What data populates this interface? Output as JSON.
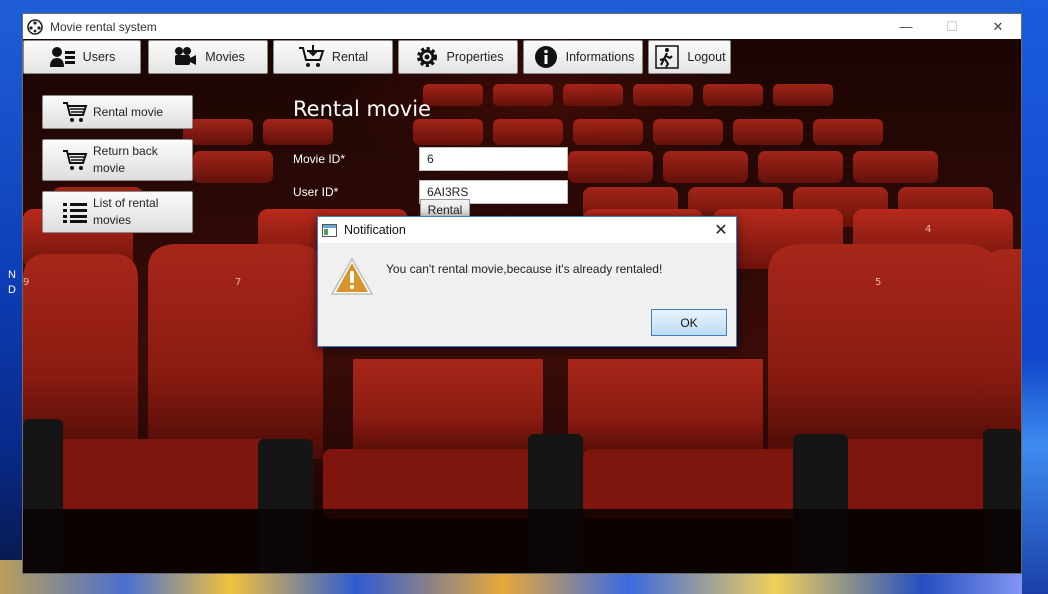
{
  "desktop": {
    "left_text": "N D"
  },
  "window": {
    "title": "Movie rental system",
    "minimize": "—",
    "maximize": "☐",
    "close": "✕"
  },
  "toolbar": {
    "users": "Users",
    "movies": "Movies",
    "rental": "Rental",
    "properties": "Properties",
    "informations": "Informations",
    "logout": "Logout"
  },
  "side_menu": {
    "rental_movie": "Rental movie",
    "return_back_movie": "Return back movie",
    "list_of_rental_movies": "List of rental movies"
  },
  "form": {
    "title": "Rental movie",
    "movie_id_label": "Movie ID*",
    "movie_id_value": "6",
    "user_id_label": "User ID*",
    "user_id_value": "6AI3RS",
    "rental_button": "Rental"
  },
  "dialog": {
    "title": "Notification",
    "close": "✕",
    "message": "You can't rental movie,because it's already rentaled!",
    "ok": "OK"
  },
  "colors": {
    "seat_red": "#9a1c12",
    "dialog_border": "#3c7fc7",
    "warning_amber": "#d8962a"
  }
}
